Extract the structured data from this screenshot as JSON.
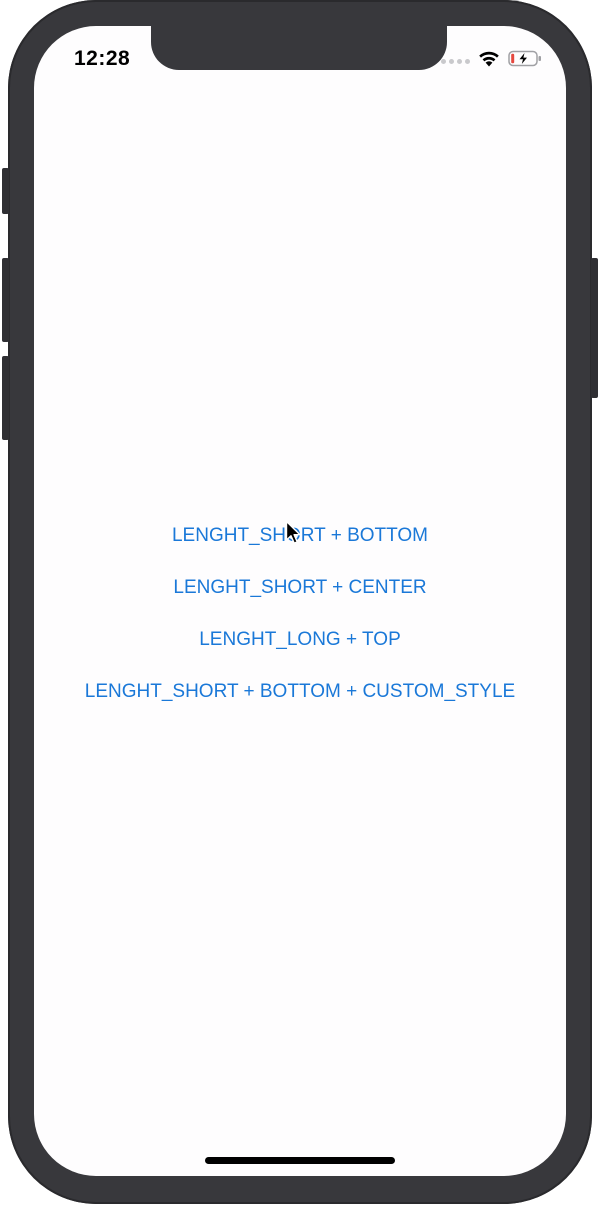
{
  "status_bar": {
    "time": "12:28",
    "icons": [
      "signal-dots-icon",
      "wifi-icon",
      "battery-charging-icon"
    ],
    "battery_color": "#e5483f"
  },
  "buttons": [
    {
      "label": "LENGHT_SHORT + BOTTOM"
    },
    {
      "label": "LENGHT_SHORT + CENTER"
    },
    {
      "label": "LENGHT_LONG + TOP"
    },
    {
      "label": "LENGHT_SHORT + BOTTOM + CUSTOM_STYLE"
    }
  ],
  "colors": {
    "accent": "#1a78d8",
    "frame": "#38383c",
    "screen_bg": "#fefdfe"
  }
}
